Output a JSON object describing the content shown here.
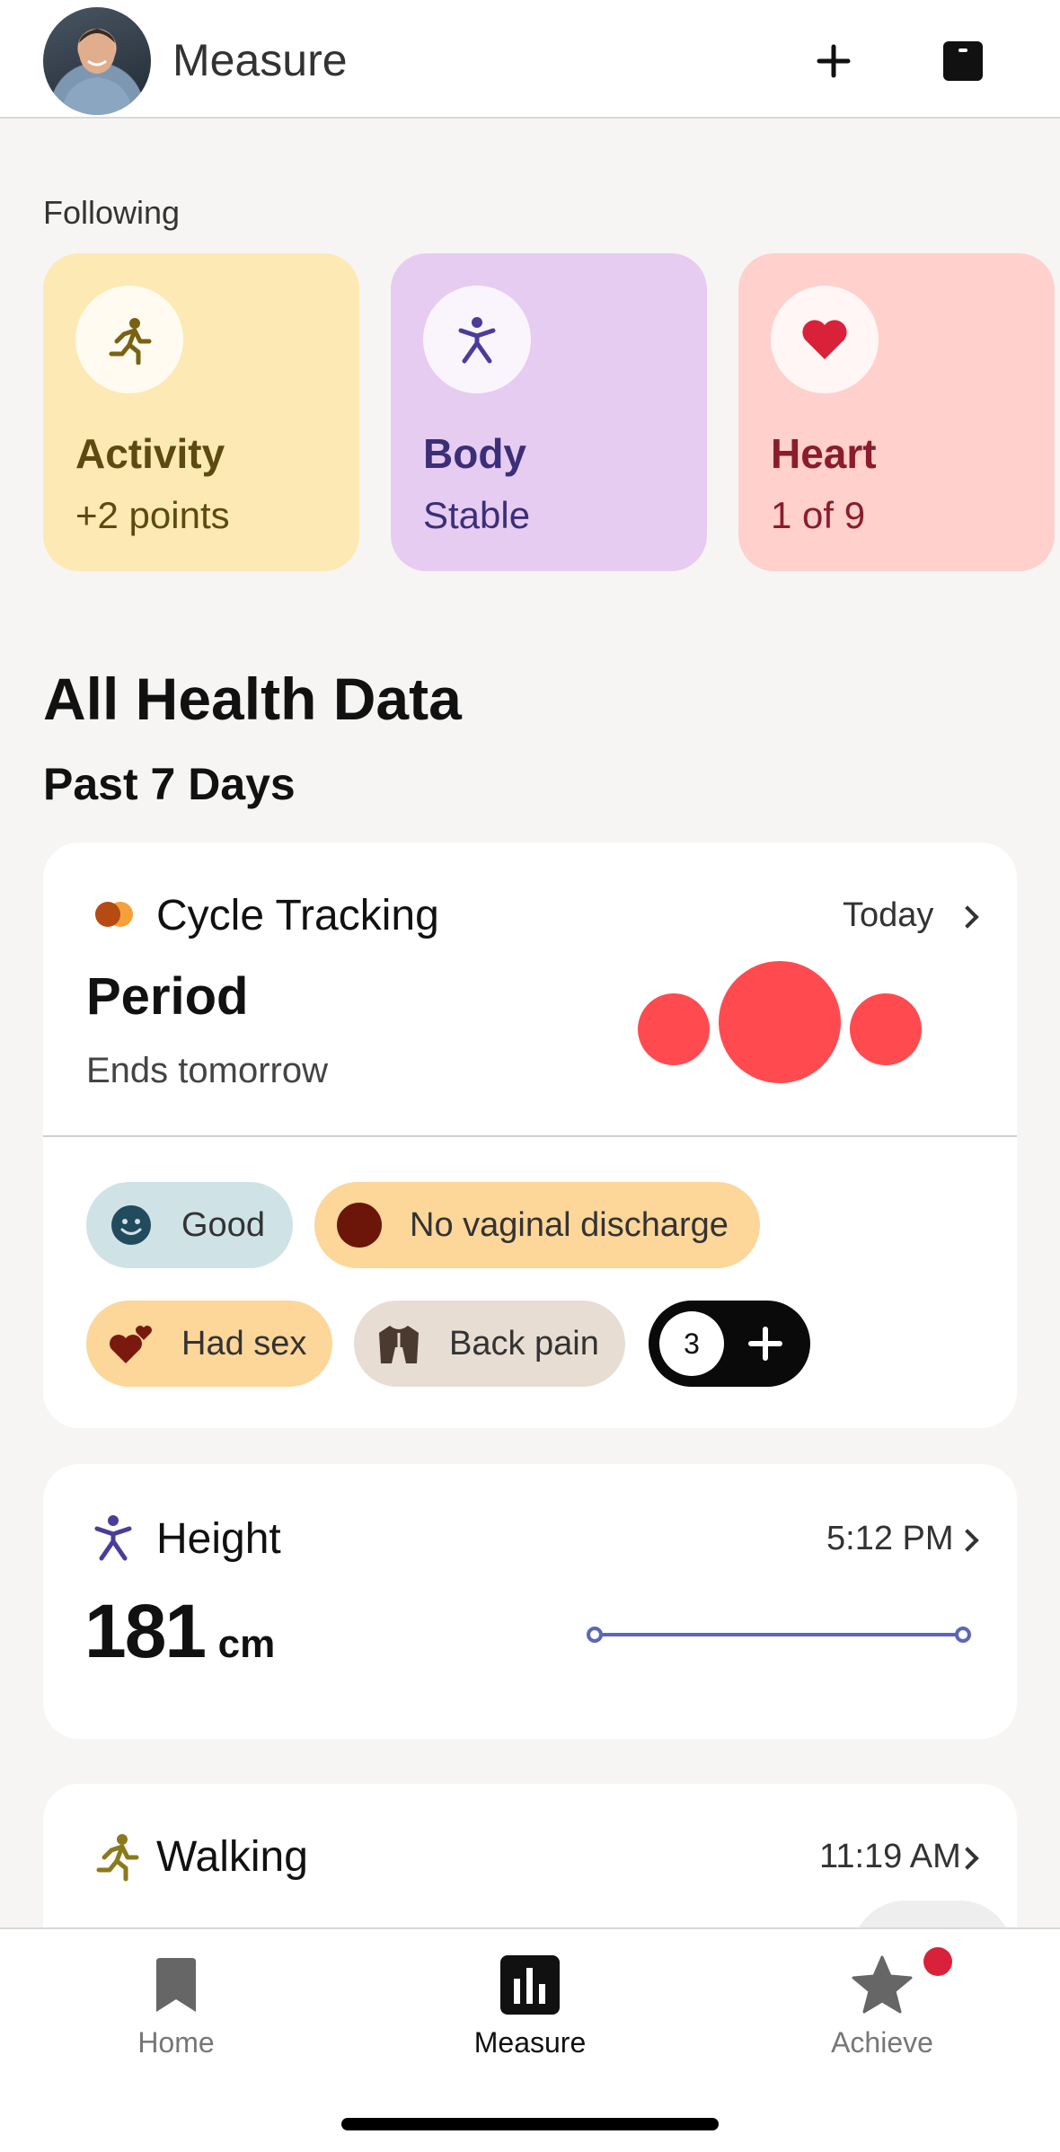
{
  "header": {
    "title": "Measure"
  },
  "following": {
    "label": "Following",
    "cards": [
      {
        "title": "Activity",
        "subtitle": "+2 points",
        "bg": "#fde9b4",
        "fg": "#5c4a12"
      },
      {
        "title": "Body",
        "subtitle": "Stable",
        "bg": "#e6ccf1",
        "fg": "#3b2f78"
      },
      {
        "title": "Heart",
        "subtitle": "1 of 9",
        "bg": "#ffd0cc",
        "fg": "#8a1c2c"
      }
    ]
  },
  "health": {
    "heading": "All Health Data",
    "period": "Past 7 Days"
  },
  "cycle": {
    "title": "Cycle Tracking",
    "time": "Today",
    "status": "Period",
    "detail": "Ends tomorrow",
    "chips": [
      {
        "label": "Good",
        "icon": "smile-face-icon",
        "bg": "#cfe3e6"
      },
      {
        "label": "No vaginal discharge",
        "icon": "discharge-dot-icon",
        "bg": "#fdd69a"
      },
      {
        "label": "Had sex",
        "icon": "hearts-icon",
        "bg": "#fdd69a"
      },
      {
        "label": "Back pain",
        "icon": "torso-icon",
        "bg": "#e8ddd3"
      }
    ],
    "more_count": "3",
    "accent": "#ff4b4f"
  },
  "height": {
    "title": "Height",
    "time": "5:12 PM",
    "value": "181",
    "unit": "cm",
    "line_color": "#5b67b6"
  },
  "walking": {
    "title": "Walking",
    "time": "11:19 AM"
  },
  "nav": {
    "items": [
      {
        "label": "Home",
        "icon": "bookmark-icon"
      },
      {
        "label": "Measure",
        "icon": "bar-chart-icon",
        "active": true
      },
      {
        "label": "Achieve",
        "icon": "star-icon",
        "badge": true
      }
    ]
  }
}
